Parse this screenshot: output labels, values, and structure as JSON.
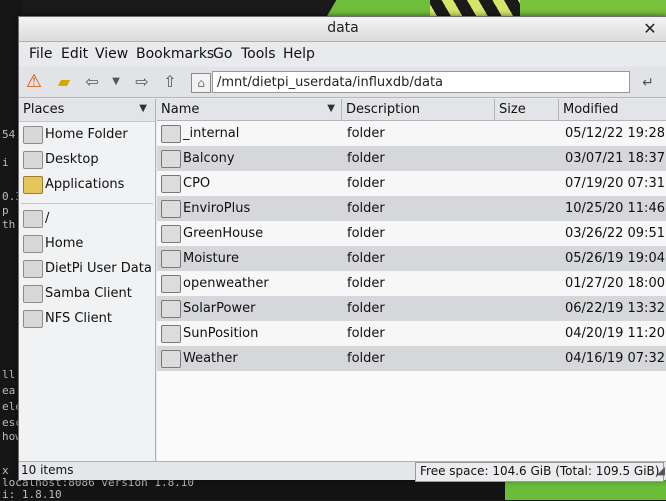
{
  "window": {
    "title": "data"
  },
  "menu": [
    "File",
    "Edit",
    "View",
    "Bookmarks",
    "Go",
    "Tools",
    "Help"
  ],
  "toolbar": {
    "path": "/mnt/dietpi_userdata/influxdb/data",
    "icons": [
      "warning-icon",
      "bookmark-icon",
      "back-icon",
      "dropdown-icon",
      "forward-icon",
      "up-icon",
      "home-icon",
      "go-icon"
    ]
  },
  "places": {
    "header": "Places",
    "items": [
      {
        "label": "Home Folder",
        "icon": "home-folder-icon"
      },
      {
        "label": "Desktop",
        "icon": "desktop-folder-icon"
      },
      {
        "label": "Applications",
        "icon": "applications-icon"
      }
    ],
    "volumes": [
      {
        "label": "/",
        "icon": "root-drive-icon"
      },
      {
        "label": "Home",
        "icon": "home-drive-icon"
      },
      {
        "label": "DietPi User Data",
        "icon": "drive-icon"
      },
      {
        "label": "Samba Client",
        "icon": "drive-icon"
      },
      {
        "label": "NFS Client",
        "icon": "drive-icon"
      }
    ]
  },
  "columns": {
    "name": "Name",
    "description": "Description",
    "size": "Size",
    "modified": "Modified"
  },
  "files": [
    {
      "name": "_internal",
      "description": "folder",
      "size": "",
      "modified": "05/12/22 19:28"
    },
    {
      "name": "Balcony",
      "description": "folder",
      "size": "",
      "modified": "03/07/21 18:37"
    },
    {
      "name": "CPO",
      "description": "folder",
      "size": "",
      "modified": "07/19/20 07:31"
    },
    {
      "name": "EnviroPlus",
      "description": "folder",
      "size": "",
      "modified": "10/25/20 11:46"
    },
    {
      "name": "GreenHouse",
      "description": "folder",
      "size": "",
      "modified": "03/26/22 09:51"
    },
    {
      "name": "Moisture",
      "description": "folder",
      "size": "",
      "modified": "05/26/19 19:04"
    },
    {
      "name": "openweather",
      "description": "folder",
      "size": "",
      "modified": "01/27/20 18:00"
    },
    {
      "name": "SolarPower",
      "description": "folder",
      "size": "",
      "modified": "06/22/19 13:32"
    },
    {
      "name": "SunPosition",
      "description": "folder",
      "size": "",
      "modified": "04/20/19 11:20"
    },
    {
      "name": "Weather",
      "description": "folder",
      "size": "",
      "modified": "04/16/19 07:32"
    }
  ],
  "status": {
    "count": "10 items",
    "free_space": "Free space: 104.6 GiB (Total: 109.5 GiB)"
  },
  "background_terminal": {
    "lines": [
      "54",
      "i",
      "0.3",
      "p",
      "th",
      "ll",
      "ea",
      "ele",
      "esc",
      "how",
      "x",
      "localhost:8086 version 1.8.10",
      "i: 1.8.10"
    ]
  },
  "colors": {
    "window_bg": "#e8e9ec",
    "row_alt": "#d6d7da",
    "desktop_green": "#6fbf3a"
  }
}
